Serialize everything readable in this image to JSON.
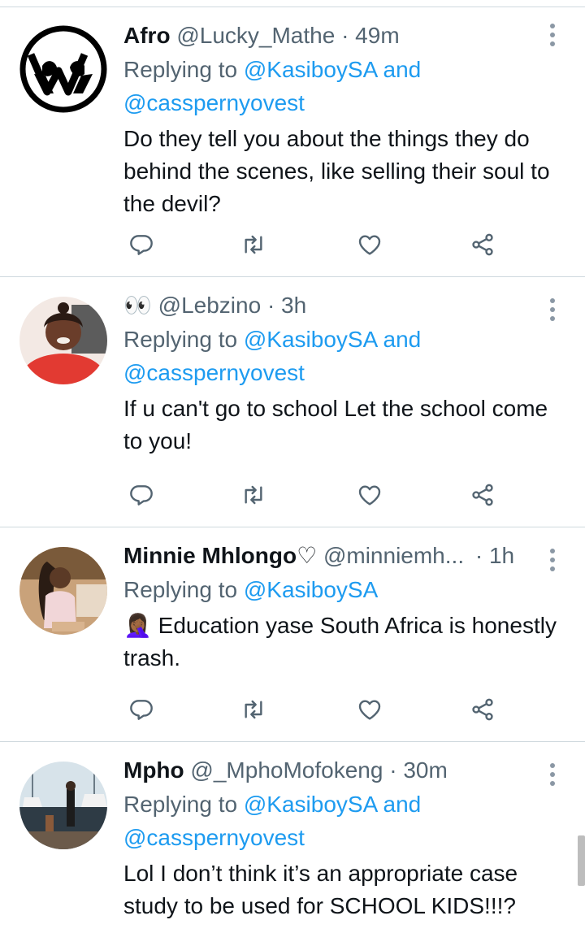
{
  "tweets": [
    {
      "display_name": "Afro",
      "handle": "@Lucky_Mathe",
      "time": "· 49m",
      "replying_prefix": "Replying to",
      "mention1": "@KasiboySA",
      "and_word": "and",
      "mention2": "@casspernyovest",
      "body": "Do they tell you about the things they do behind the scenes, like selling their soul to the devil?"
    },
    {
      "display_name": "👀",
      "handle": "@Lebzino",
      "time": "· 3h",
      "replying_prefix": "Replying to",
      "mention1": "@KasiboySA",
      "and_word": "and",
      "mention2": "@casspernyovest",
      "body": "If u can't go to school Let the school come to you!"
    },
    {
      "display_name": "Minnie Mhlongo♡",
      "handle": "@minniemh...",
      "time": "· 1h",
      "replying_prefix": "Replying to",
      "mention1": "@KasiboySA",
      "emoji": "🤦🏾‍♀️",
      "body": "Education yase South Africa is honestly trash."
    },
    {
      "display_name": "Mpho",
      "handle": "@_MphoMofokeng",
      "time": "· 30m",
      "replying_prefix": "Replying to",
      "mention1": "@KasiboySA",
      "and_word": "and",
      "mention2": "@casspernyovest",
      "body": "Lol I don’t think it’s an appropriate case study to be used for SCHOOL KIDS!!!?"
    }
  ],
  "icons": {
    "reply": "reply-icon",
    "retweet": "retweet-icon",
    "like": "like-icon",
    "share": "share-icon",
    "more": "more-options-icon"
  },
  "colors": {
    "mention": "#1d9bf0",
    "secondary_text": "#536471",
    "divider": "#cfd9de"
  }
}
